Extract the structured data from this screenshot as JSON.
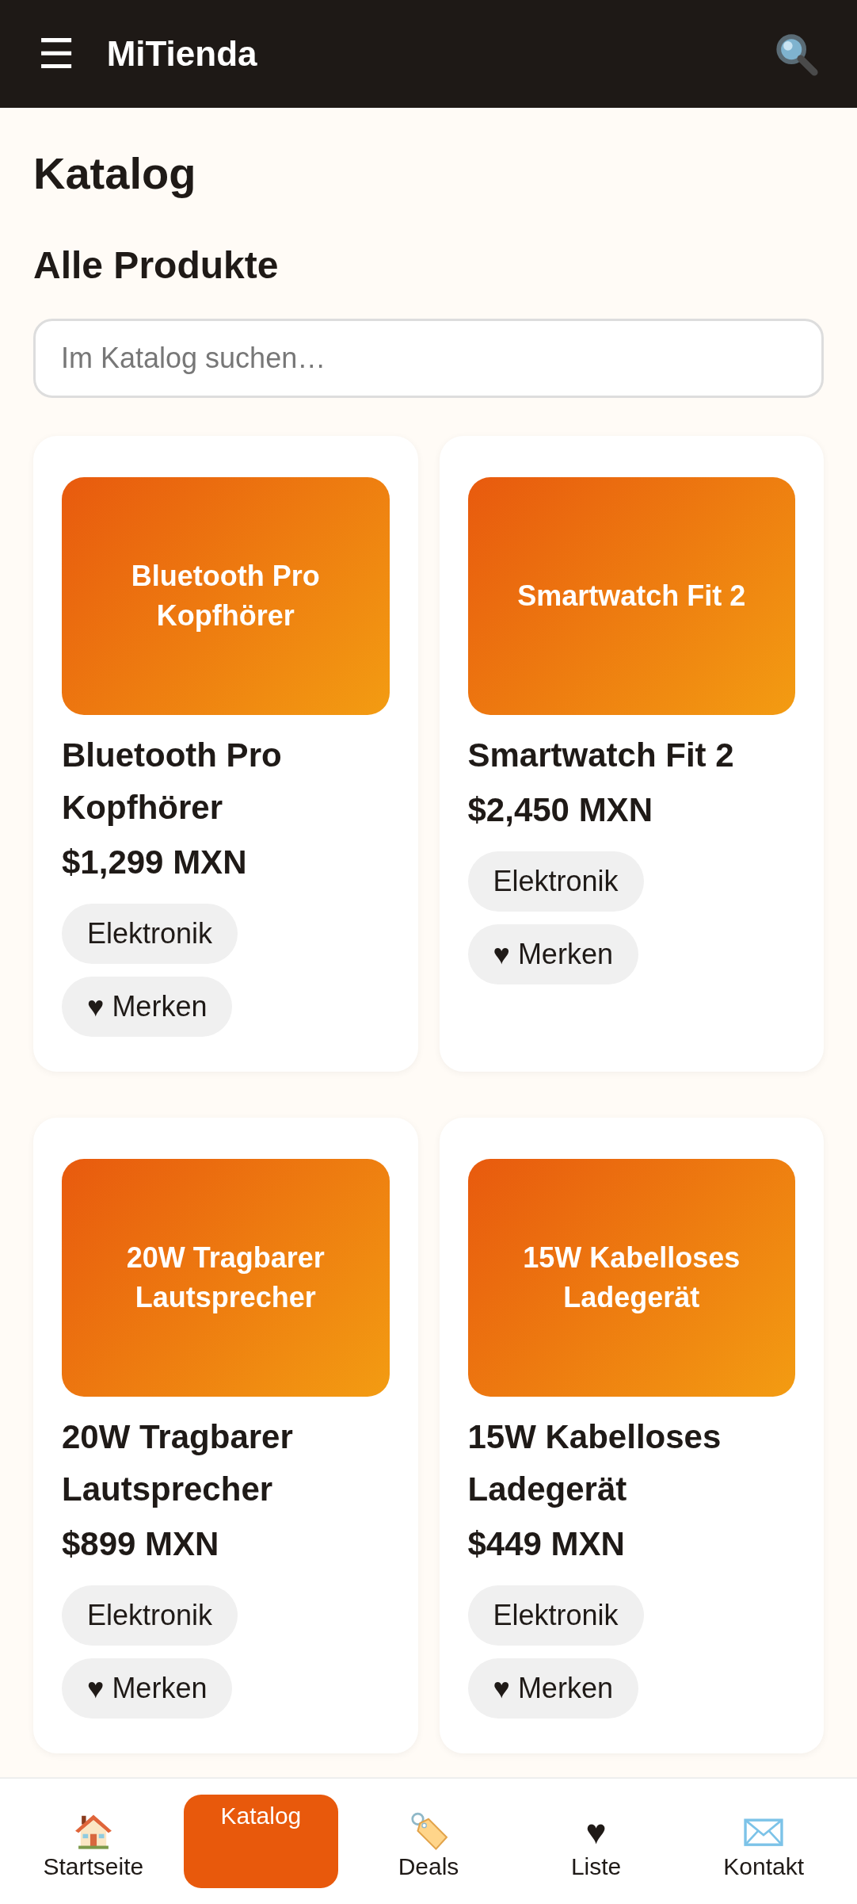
{
  "header": {
    "menu_glyph": "☰",
    "brand": "MiTienda"
  },
  "page_title": "Katalog",
  "section_title": "Alle Produkte",
  "search": {
    "placeholder": "Im Katalog suchen…"
  },
  "products": [
    {
      "image_label": "Bluetooth Pro Kopfhörer",
      "name": "Bluetooth Pro Kopfhörer",
      "price": "$1,299 MXN",
      "category": "Elektronik",
      "save_label": "♥ Merken"
    },
    {
      "image_label": "Smartwatch Fit 2",
      "name": "Smartwatch Fit 2",
      "price": "$2,450 MXN",
      "category": "Elektronik",
      "save_label": "♥ Merken"
    },
    {
      "image_label": "20W Tragbarer Lautsprecher",
      "name": "20W Tragbarer Lautsprecher",
      "price": "$899 MXN",
      "category": "Elektronik",
      "save_label": "♥ Merken"
    },
    {
      "image_label": "15W Kabelloses Ladegerät",
      "name": "15W Kabelloses Ladegerät",
      "price": "$449 MXN",
      "category": "Elektronik",
      "save_label": "♥ Merken"
    }
  ],
  "bottom_nav": [
    {
      "label": "Startseite",
      "kind": "house",
      "selected": false
    },
    {
      "label": "Katalog",
      "kind": "plain",
      "selected": true
    },
    {
      "label": "Deals",
      "kind": "tag",
      "selected": false
    },
    {
      "label": "Liste",
      "kind": "glyph",
      "glyph": "♥",
      "selected": false
    },
    {
      "label": "Kontakt",
      "kind": "envelope",
      "selected": false
    }
  ]
}
